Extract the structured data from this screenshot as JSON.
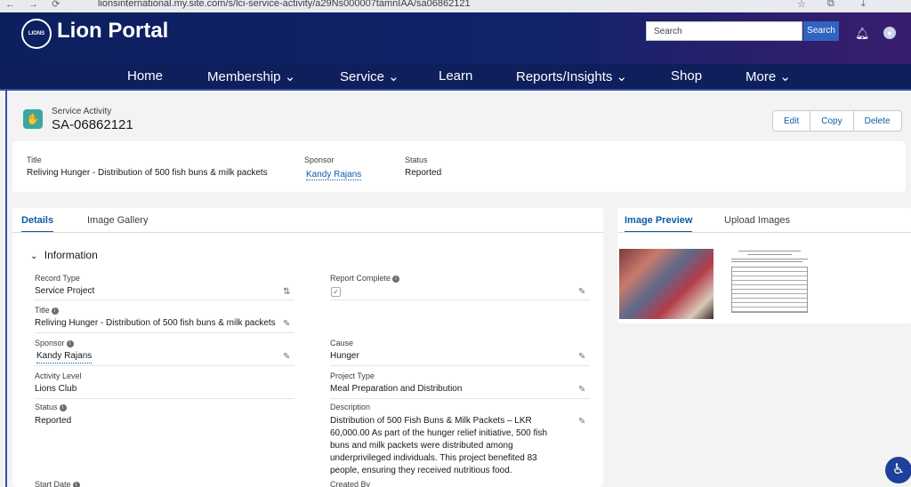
{
  "browser": {
    "url": "lionsinternational.my.site.com/s/lci-service-activity/a29Ns000007tamnIAA/sa06862121"
  },
  "header": {
    "brand": "Lion Portal",
    "logo_text": "LIONS",
    "search_placeholder": "Search",
    "search_button": "Search"
  },
  "menu": [
    {
      "label": "Home"
    },
    {
      "label": "Membership ⌄"
    },
    {
      "label": "Service ⌄"
    },
    {
      "label": "Learn"
    },
    {
      "label": "Reports/Insights ⌄"
    },
    {
      "label": "Shop"
    },
    {
      "label": "More ⌄"
    }
  ],
  "record": {
    "type": "Service Activity",
    "name": "SA-06862121",
    "buttons": {
      "edit": "Edit",
      "copy": "Copy",
      "delete": "Delete"
    }
  },
  "highlights": {
    "title_label": "Title",
    "title_value": "Reliving Hunger - Distribution of 500 fish buns & milk packets",
    "sponsor_label": "Sponsor",
    "sponsor_value": "Kandy Rajans",
    "status_label": "Status",
    "status_value": "Reported"
  },
  "tabs": {
    "details": "Details",
    "gallery": "Image Gallery"
  },
  "section": {
    "title": "Information"
  },
  "fields": {
    "record_type_label": "Record Type",
    "record_type_value": "Service Project",
    "report_complete_label": "Report Complete",
    "title_label": "Title",
    "title_value": "Reliving Hunger - Distribution of 500 fish buns & milk packets",
    "sponsor_label": "Sponsor",
    "sponsor_value": "Kandy Rajans",
    "cause_label": "Cause",
    "cause_value": "Hunger",
    "activity_level_label": "Activity Level",
    "activity_level_value": "Lions Club",
    "project_type_label": "Project Type",
    "project_type_value": "Meal Preparation and Distribution",
    "status_label": "Status",
    "status_value": "Reported",
    "description_label": "Description",
    "description_value": "Distribution of 500 Fish Buns & Milk Packets – LKR 60,000.00 As part of the hunger relief initiative, 500 fish buns and milk packets were distributed among underprivileged individuals. This project benefited 83 people, ensuring they received nutritious food.",
    "start_date_label": "Start Date",
    "created_by_label": "Created By"
  },
  "right_tabs": {
    "preview": "Image Preview",
    "upload": "Upload Images"
  }
}
